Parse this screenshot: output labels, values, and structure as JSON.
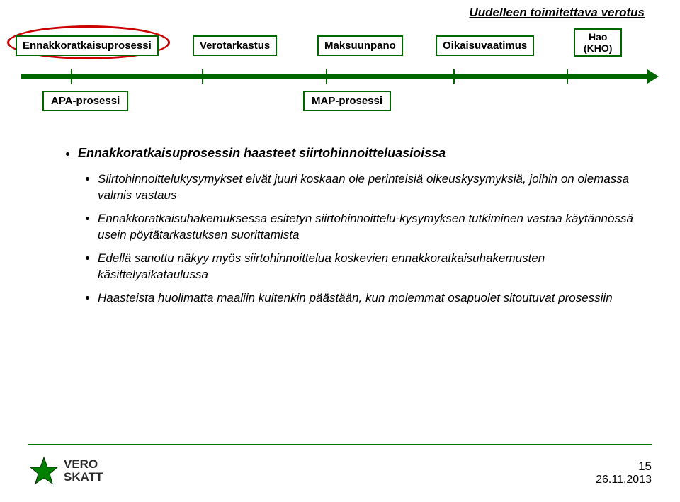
{
  "header": {
    "top_right": "Uudelleen toimitettava verotus"
  },
  "process": {
    "box1": "Ennakkoratkaisuprosessi",
    "box2": "Verotarkastus",
    "box3": "Maksuunpano",
    "box4": "Oikaisuvaatimus",
    "box5_line1": "Hao",
    "box5_line2": "(KHO)"
  },
  "subprocess": {
    "apa": "APA-prosessi",
    "map": "MAP-prosessi"
  },
  "content": {
    "title": "Ennakkoratkaisuprosessin haasteet siirtohinnoitteluasioissa",
    "bullet1": "Siirtohinnoittelukysymykset eivät juuri koskaan ole perinteisiä oikeuskysymyksiä, joihin on olemassa valmis vastaus",
    "bullet2": "Ennakkoratkaisuhakemuksessa esitetyn siirtohinnoittelu-kysymyksen tutkiminen vastaa käytännössä usein pöytätarkastuksen suorittamista",
    "bullet3": "Edellä sanottu näkyy myös siirtohinnoittelua koskevien ennakkoratkaisuhakemusten käsittelyaikataulussa",
    "bullet4": "Haasteista huolimatta maaliin kuitenkin päästään, kun molemmat osapuolet sitoutuvat prosessiin"
  },
  "footer": {
    "logo_text": "VERO SKATT",
    "page": "15",
    "date": "26.11.2013"
  }
}
